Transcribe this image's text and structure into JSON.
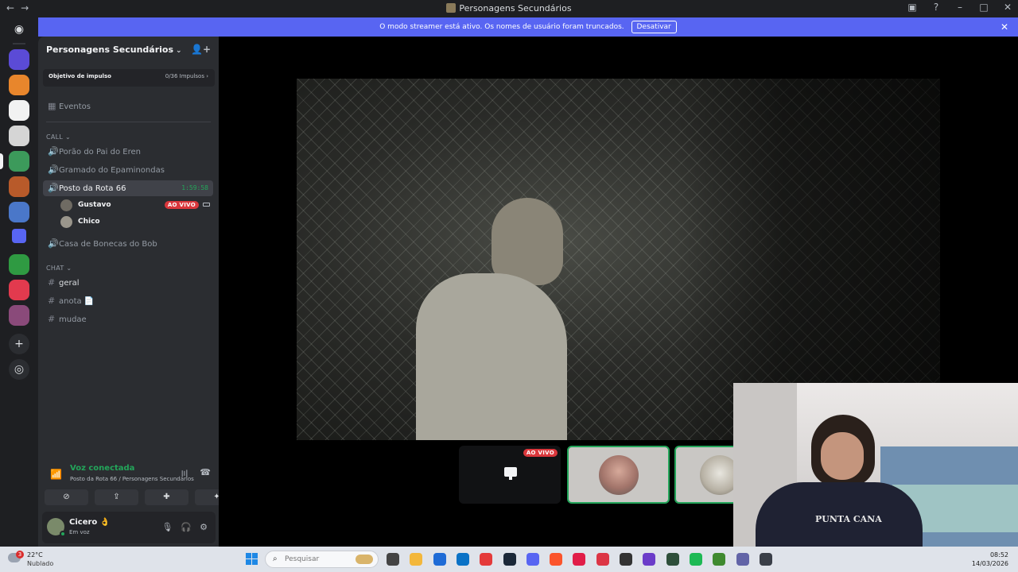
{
  "window": {
    "title": "Personagens Secundários",
    "back": "←",
    "forward": "→",
    "controls": {
      "screen": "▣",
      "help": "?",
      "minimize": "–",
      "maximize": "□",
      "close": "✕"
    }
  },
  "banner": {
    "text": "O modo streamer está ativo. Os nomes de usuário foram truncados.",
    "button": "Desativar",
    "close": "✕"
  },
  "server": {
    "name": "Personagens Secundários",
    "chevron": "⌄",
    "invite_icon": "👤+",
    "boost": {
      "label": "Objetivo de impulso",
      "progress": "0/36 Impulsos ›"
    },
    "events": "Eventos",
    "categories": {
      "call": "CALL ⌄",
      "chat": "CHAT ⌄"
    },
    "voice_channels": [
      {
        "name": "Porão do Pai do Eren"
      },
      {
        "name": "Gramado do Epaminondas"
      },
      {
        "name": "Posto da Rota 66",
        "timer": "1:59:58"
      },
      {
        "name": "Casa de Bonecas do Bob"
      }
    ],
    "voice_users": [
      {
        "name": "Gustavo",
        "badge": "AO VIVO"
      },
      {
        "name": "Chico"
      }
    ],
    "text_channels": [
      {
        "name": "geral"
      },
      {
        "name": "anota 📄"
      },
      {
        "name": "mudae"
      }
    ]
  },
  "voice_panel": {
    "status": "Voz conectada",
    "location": "Posto da Rota 66 / Personagens Secundários",
    "icons": {
      "signal": "📶",
      "soundboard": "〣",
      "disconnect": "☎"
    },
    "buttons": [
      "⊘",
      "⇪",
      "✚",
      "✦"
    ]
  },
  "user_panel": {
    "name": "Cicero 👌",
    "status": "Em voz",
    "icons": {
      "mic": "🎙",
      "headset": "🎧",
      "settings": "⚙"
    }
  },
  "stage": {
    "live_badge": "AO VIVO",
    "camera_shirt_text": "PUNTA CANA"
  },
  "rail": {
    "home_icon": "◉",
    "add_icon": "+",
    "discover_icon": "◎",
    "server_colors": [
      "#5b4bd6",
      "#e8862c",
      "#f2f2f2",
      "#d5d5d5",
      "#3c9a5b",
      "#b85a2a",
      "#4a77c9",
      "#5865f2",
      "#2f9a42",
      "#e23a4e",
      "#8a4a7a"
    ]
  },
  "taskbar": {
    "weather": {
      "temp": "22°C",
      "condition": "Nublado",
      "badge": "3"
    },
    "search_placeholder": "Pesquisar",
    "time": "08:52",
    "date": "14/03/2026",
    "app_colors": [
      "#444",
      "#f3b73b",
      "#1e6bd6",
      "#0a72c6",
      "#e43a3a",
      "#1b2838",
      "#5865f2",
      "#fb542b",
      "#e11d48",
      "#dc3545",
      "#333",
      "#6b3cc9",
      "#2e4f3a",
      "#1db954",
      "#3f8a2f",
      "#6264a7",
      "#3a3f48"
    ]
  }
}
